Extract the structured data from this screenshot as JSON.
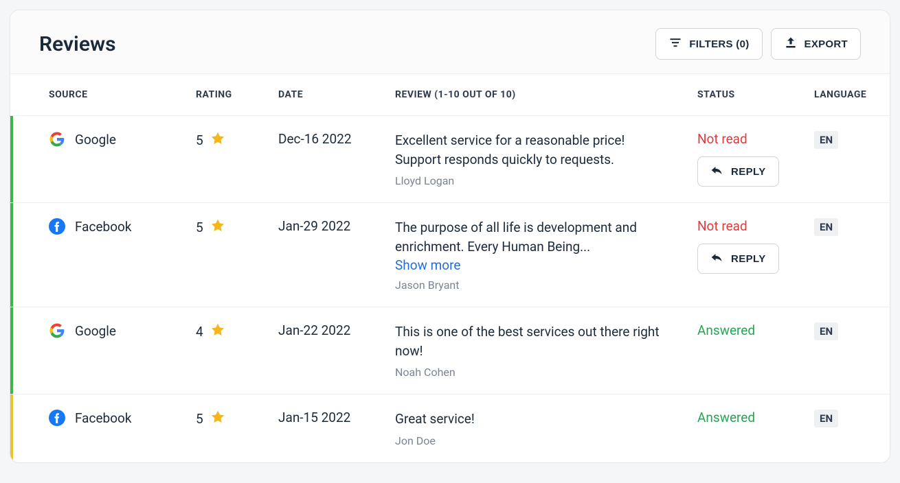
{
  "header": {
    "title": "Reviews",
    "filters_label": "FILTERS (0)",
    "export_label": "EXPORT"
  },
  "columns": {
    "source": "SOURCE",
    "rating": "RATING",
    "date": "DATE",
    "review": "REVIEW (1-10 OUT OF 10)",
    "status": "STATUS",
    "language": "LANGUAGE"
  },
  "labels": {
    "reply": "REPLY",
    "show_more": "Show more"
  },
  "accent_colors": {
    "green": "#3fb548",
    "yellow": "#e9c32b"
  },
  "rows": [
    {
      "accent": "green",
      "source": "Google",
      "source_icon": "google",
      "rating": 5,
      "date": "Dec-16 2022",
      "review": "Excellent service for a reasonable price! Support responds quickly to requests.",
      "show_more": false,
      "author": "Lloyd Logan",
      "status": "Not read",
      "status_kind": "notread",
      "has_reply": true,
      "language": "EN"
    },
    {
      "accent": "green",
      "source": "Facebook",
      "source_icon": "facebook",
      "rating": 5,
      "date": "Jan-29 2022",
      "review": "The purpose of all life is development and enrichment. Every Human Being...",
      "show_more": true,
      "author": "Jason Bryant",
      "status": "Not read",
      "status_kind": "notread",
      "has_reply": true,
      "language": "EN"
    },
    {
      "accent": "green",
      "source": "Google",
      "source_icon": "google",
      "rating": 4,
      "date": "Jan-22 2022",
      "review": "This is one of the best services out there right now!",
      "show_more": false,
      "author": "Noah Cohen",
      "status": "Answered",
      "status_kind": "answered",
      "has_reply": false,
      "language": "EN"
    },
    {
      "accent": "yellow",
      "source": "Facebook",
      "source_icon": "facebook",
      "rating": 5,
      "date": "Jan-15 2022",
      "review": "Great service!",
      "show_more": false,
      "author": "Jon Doe",
      "status": "Answered",
      "status_kind": "answered",
      "has_reply": false,
      "language": "EN"
    }
  ]
}
